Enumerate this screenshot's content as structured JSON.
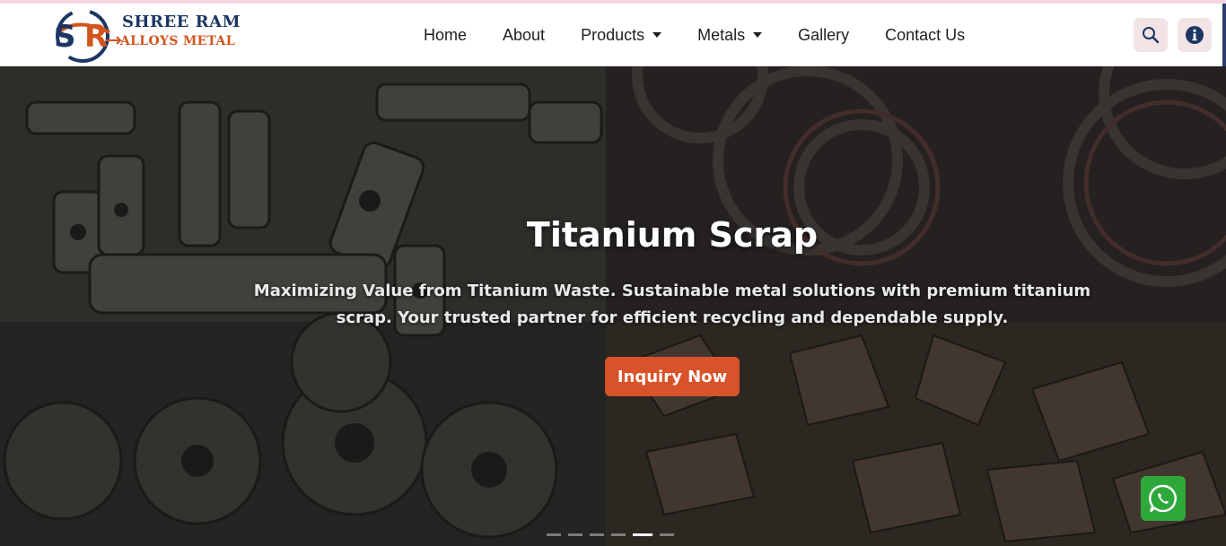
{
  "brand": {
    "name": "SHREE RAM",
    "subtitle": "ALLOYS METAL",
    "colors": {
      "navy": "#1c3664",
      "orange": "#d2551e"
    }
  },
  "nav": {
    "items": [
      {
        "label": "Home",
        "has_dropdown": false
      },
      {
        "label": "About",
        "has_dropdown": false
      },
      {
        "label": "Products",
        "has_dropdown": true
      },
      {
        "label": "Metals",
        "has_dropdown": true
      },
      {
        "label": "Gallery",
        "has_dropdown": false
      },
      {
        "label": "Contact Us",
        "has_dropdown": false
      }
    ]
  },
  "header_actions": {
    "search_icon": "search-icon",
    "info_icon": "info-icon"
  },
  "hero": {
    "title": "Titanium Scrap",
    "description": "Maximizing Value from Titanium Waste. Sustainable metal solutions with premium titanium scrap. Your trusted partner for efficient recycling and dependable supply.",
    "cta_label": "Inquiry Now",
    "cta_color": "#d8522a",
    "slides_total": 6,
    "active_slide": 5
  },
  "floating": {
    "whatsapp_icon": "whatsapp-icon",
    "whatsapp_color": "#2fa83b"
  }
}
